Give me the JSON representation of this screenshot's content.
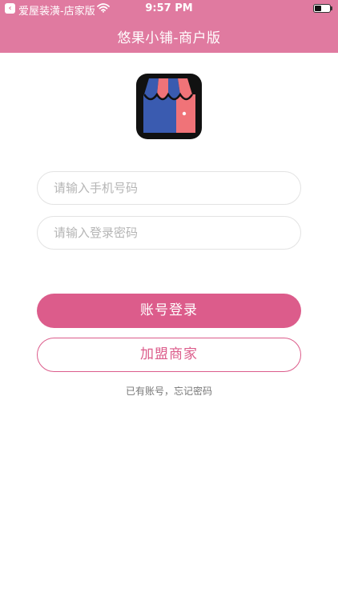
{
  "status_bar": {
    "back_app": "爱屋装潢-店家版",
    "time": "9:57 PM",
    "battery_level": 0.45,
    "icons": [
      "back-arrow-icon",
      "wifi-icon",
      "battery-icon"
    ]
  },
  "nav": {
    "title": "悠果小铺-商户版"
  },
  "logo": {
    "icon": "storefront-icon",
    "colors": {
      "awning_blue": "#3a5bb0",
      "awning_pink": "#f07378",
      "frame": "#111111"
    }
  },
  "form": {
    "phone_placeholder": "请输入手机号码",
    "phone_value": "",
    "password_placeholder": "请输入登录密码",
    "password_value": ""
  },
  "actions": {
    "login_label": "账号登录",
    "join_label": "加盟商家",
    "have_account": "已有账号",
    "separator": "，",
    "forgot_password": "忘记密码"
  },
  "colors": {
    "brand": "#e07aa0",
    "primary_button": "#dc5c8b"
  }
}
